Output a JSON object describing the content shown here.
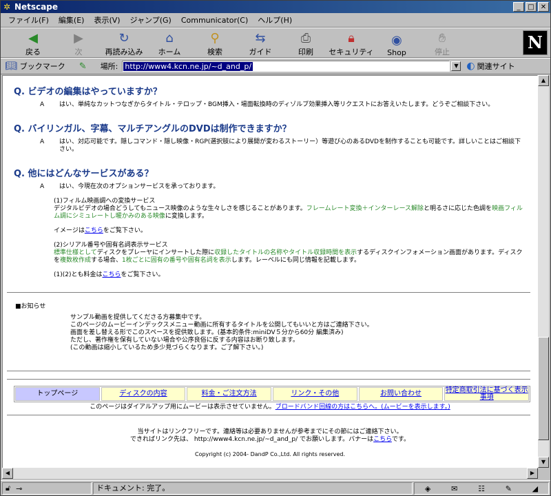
{
  "window": {
    "title": "Netscape"
  },
  "menu": [
    "ファイル(F)",
    "編集(E)",
    "表示(V)",
    "ジャンプ(G)",
    "Communicator(C)",
    "ヘルプ(H)"
  ],
  "toolbar": {
    "back": "戻る",
    "forward": "次",
    "reload": "再読み込み",
    "home": "ホーム",
    "search": "検索",
    "guide": "ガイド",
    "print": "印刷",
    "security": "セキュリティ",
    "shop": "Shop",
    "stop": "停止"
  },
  "location": {
    "bookmarks_label": "ブックマーク",
    "location_label": "場所:",
    "url": "http://www4.kcn.ne.jp/~d_and_p/",
    "related_label": "関連サイト"
  },
  "page": {
    "q1": {
      "title": "Q. ビデオの編集はやっていますか？",
      "a_mark": "A",
      "answer": "はい、単純なカットつなぎからタイトル・テロップ・BGM挿入・場面転換時のディゾルブ効果挿入等リクエストにお答えいたします。どうぞご相談下さい。"
    },
    "q2": {
      "title": "Q. バイリンガル、字幕、マルチアングルのDVDは制作できますか？",
      "a_mark": "A",
      "answer": "はい、対応可能です。隠しコマンド・隠し映像・RGP(選択肢により展開が変わるストーリー）等遊び心のあるDVDを制作することも可能です。詳しいことはご相談下さい。"
    },
    "q3": {
      "title": "Q. 他にはどんなサービスがある？",
      "a_mark": "A",
      "intro": "はい、今現在次のオプションサービスを承っております。",
      "s1_title": "(1)フィルム映画調への変換サービス",
      "s1_line1_a": "デジタルビデオの場合どうしてもニュース映像のような生々しさを感じることがあります。",
      "s1_line1_green": "フレームレート変換＋インターレース解除",
      "s1_line1_b": "と明るさに応じた色調を",
      "s1_line1_green2": "映画フィルム調にシミュレートし暖かみのある映像",
      "s1_line1_c": "に変換します。",
      "s1_image_a": "イメージは",
      "s1_image_link": "こちら",
      "s1_image_b": "をご覧下さい。",
      "s2_title": "(2)シリアル番号や固有名詞表示サービス",
      "s2_green1": "標準仕様として",
      "s2_a": "ディスクをプレーヤにインサートした際に",
      "s2_green2": "収録したタイトルの名称やタイトル収録時間を表示",
      "s2_b": "するディスクインフォメーション画面があります。ディスクを",
      "s2_green3": "複数枚作成",
      "s2_c": "する場合、",
      "s2_green4": "1枚ごとに固有の番号や固有名詞を表示",
      "s2_d": "します。レーベルにも同じ情報を記載します。",
      "fee_a": "(1)(2)とも料金は",
      "fee_link": "こちら",
      "fee_b": "をご覧下さい。"
    },
    "notice": {
      "heading": "■お知らせ",
      "lines": [
        "サンプル動画を提供してくださる方募集中です。",
        "このページのムービーインデックスメニュー動画に所有するタイトルを公開してもいいと方はご連絡下さい。",
        "画面を差し替える形でこのスペースを提供致します。(基本的条件:miniDV５分から60分 編集済み)",
        "ただし、著作権を保有していない場合や公序良俗に反する内容はお断り致します。",
        "(この動画は縮小しているため多少見づらくなります。ご了解下さい。)"
      ]
    },
    "nav": [
      "トップページ",
      "ディスクの内容",
      "料金・ご注文方法",
      "リンク・その他",
      "お問い合わせ",
      "特定商取引法に基づく表示事項"
    ],
    "dialup_a": "このページはダイアルアップ用にムービーは表示させていません。",
    "dialup_link": "ブロードバンド回線の方はこちらへ。(ムービーを表示します。)",
    "footer1": "当サイトはリンクフリーです。連絡等は必要ありませんが参考までにその節にはご連絡下さい。",
    "footer2_a": "できればリンク先は、 http://www4.kcn.ne.jp/~d_and_p/ でお願いします。バナーは",
    "footer2_link": "こちら",
    "footer2_b": "です。",
    "copyright": "Copyright (c) 2004- DandP Co.,Ltd. All rights reserved."
  },
  "status": {
    "message": "ドキュメント: 完了。"
  }
}
